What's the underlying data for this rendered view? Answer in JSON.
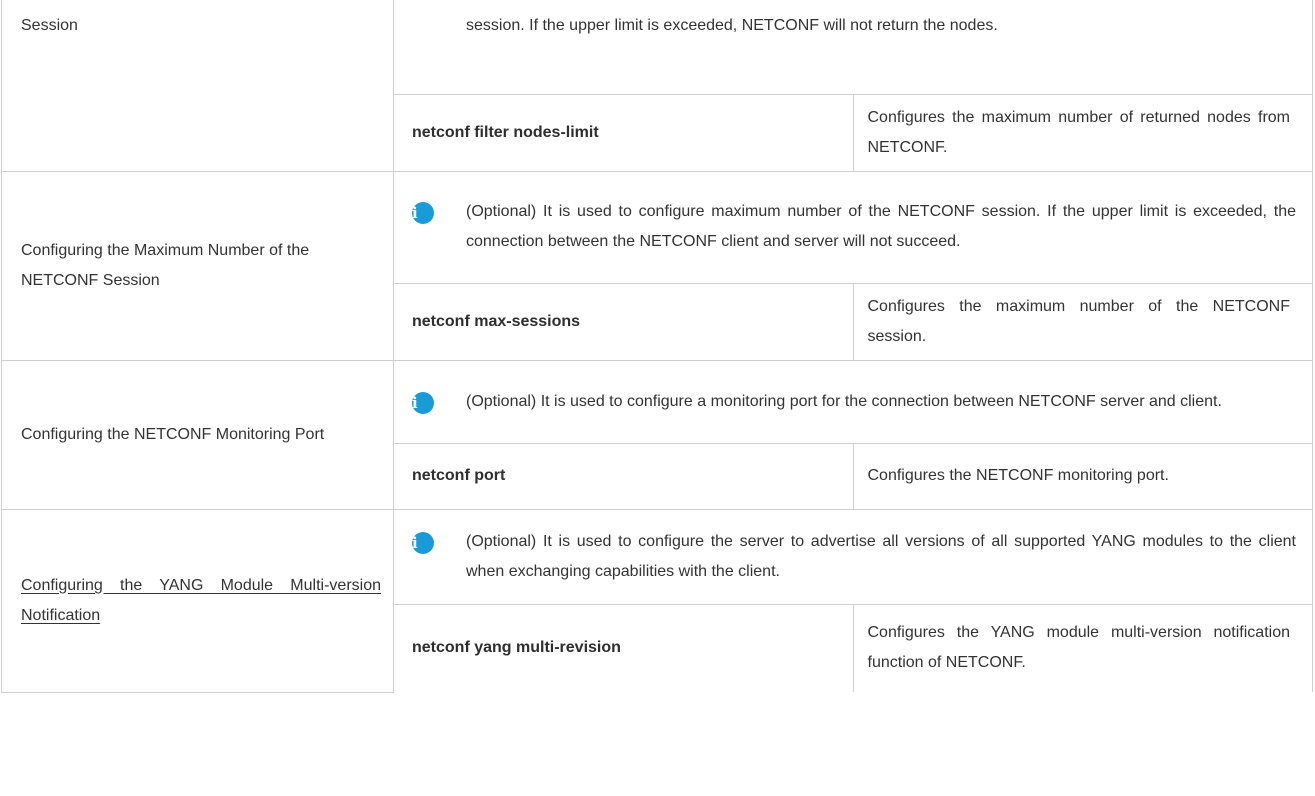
{
  "rows": [
    {
      "config_name": "Session",
      "note": "session. If the upper limit is exceeded, NETCONF will not return the nodes.",
      "command": "netconf filter nodes-limit",
      "description": "Configures the maximum number of returned nodes from NETCONF."
    },
    {
      "config_name": "Configuring the Maximum Number of the NETCONF Session",
      "note": "(Optional) It is used to configure maximum number of the NETCONF session. If the upper limit is exceeded, the connection between the NETCONF client and server will not succeed.",
      "command": "netconf max-sessions",
      "description": "Configures the maximum number of the NETCONF session."
    },
    {
      "config_name": "Configuring the NETCONF Monitoring Port",
      "note": "(Optional) It is used to configure a monitoring port for the connection between NETCONF server and client.",
      "command": "netconf port",
      "description": "Configures the NETCONF monitoring port."
    },
    {
      "config_name": "Configuring the YANG Module Multi-version Notification",
      "note": "(Optional) It is used to configure the server to advertise all versions of all supported YANG modules to the client when exchanging capabilities with the client.",
      "command": "netconf yang multi-revision",
      "description": "Configures the YANG module multi-version notification function of NETCONF."
    }
  ],
  "icons": {
    "note": "info-icon",
    "note_glyph": "i",
    "note_color": "#1a9bd7"
  }
}
